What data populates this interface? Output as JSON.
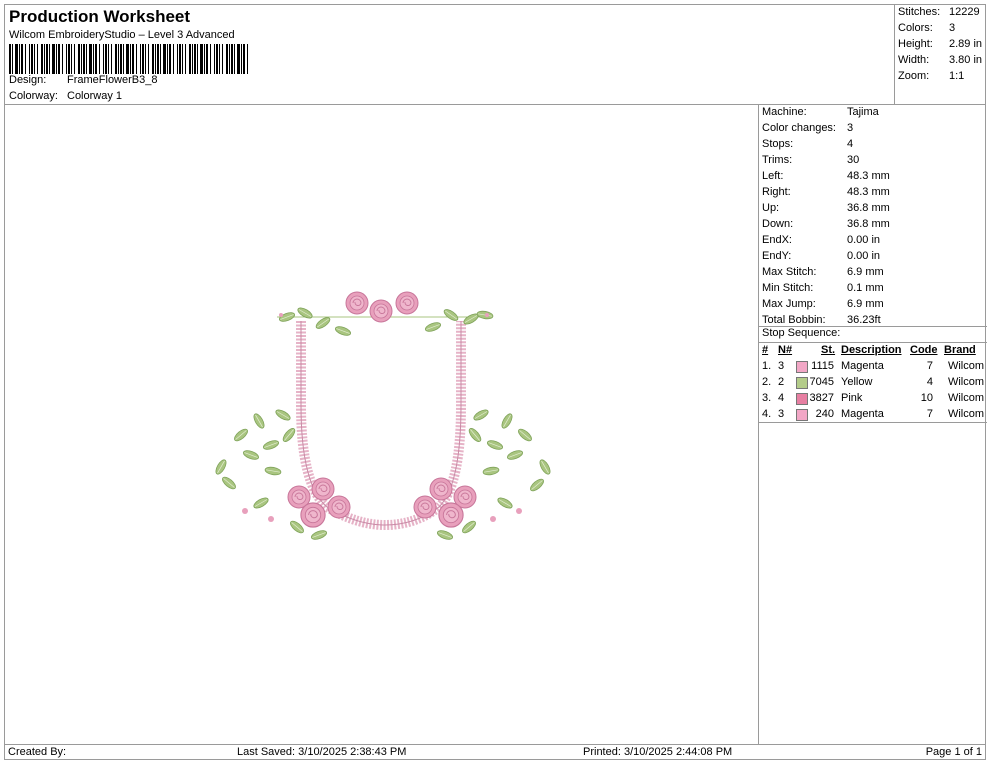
{
  "header": {
    "title": "Production Worksheet",
    "subtitle": "Wilcom EmbroideryStudio – Level 3 Advanced",
    "design_label": "Design:",
    "design_value": "FrameFlowerB3_8",
    "colorway_label": "Colorway:",
    "colorway_value": "Colorway 1"
  },
  "stats": [
    {
      "k": "Stitches:",
      "v": "12229"
    },
    {
      "k": "Colors:",
      "v": "3"
    },
    {
      "k": "Height:",
      "v": "2.89 in"
    },
    {
      "k": "Width:",
      "v": "3.80 in"
    },
    {
      "k": "Zoom:",
      "v": "1:1"
    }
  ],
  "machine": [
    {
      "k": "Machine:",
      "v": "Tajima"
    },
    {
      "k": "Color changes:",
      "v": "3"
    },
    {
      "k": "Stops:",
      "v": "4"
    },
    {
      "k": "Trims:",
      "v": "30"
    },
    {
      "k": "Left:",
      "v": "48.3 mm"
    },
    {
      "k": "Right:",
      "v": "48.3 mm"
    },
    {
      "k": "Up:",
      "v": "36.8 mm"
    },
    {
      "k": "Down:",
      "v": "36.8 mm"
    },
    {
      "k": "EndX:",
      "v": "0.00 in"
    },
    {
      "k": "EndY:",
      "v": "0.00 in"
    },
    {
      "k": "Max Stitch:",
      "v": "6.9 mm"
    },
    {
      "k": "Min Stitch:",
      "v": "0.1 mm"
    },
    {
      "k": "Max Jump:",
      "v": "6.9 mm"
    },
    {
      "k": "Total Bobbin:",
      "v": "36.23ft"
    }
  ],
  "stop_sequence": {
    "title": "Stop Sequence:",
    "headers": {
      "num": "#",
      "n": "N#",
      "st": "St.",
      "desc": "Description",
      "code": "Code",
      "brand": "Brand"
    },
    "rows": [
      {
        "num": "1.",
        "n": "3",
        "st": "1115",
        "desc": "Magenta",
        "code": "7",
        "brand": "Wilcom",
        "color": "#f2a7c6"
      },
      {
        "num": "2.",
        "n": "2",
        "st": "7045",
        "desc": "Yellow",
        "code": "4",
        "brand": "Wilcom",
        "color": "#b4cc8a"
      },
      {
        "num": "3.",
        "n": "4",
        "st": "3827",
        "desc": "Pink",
        "code": "10",
        "brand": "Wilcom",
        "color": "#e77fa2"
      },
      {
        "num": "4.",
        "n": "3",
        "st": "240",
        "desc": "Magenta",
        "code": "7",
        "brand": "Wilcom",
        "color": "#f2a7c6"
      }
    ]
  },
  "footer": {
    "created": "Created By:",
    "saved": "Last Saved: 3/10/2025 2:38:43 PM",
    "printed": "Printed: 3/10/2025 2:44:08 PM",
    "page": "Page 1 of 1"
  },
  "colors": {
    "rose": "#e8a0bc",
    "rose_dark": "#c8769a",
    "leaf": "#a9c580",
    "leaf_dark": "#7fa35a",
    "frame": "#e6b3c7"
  }
}
